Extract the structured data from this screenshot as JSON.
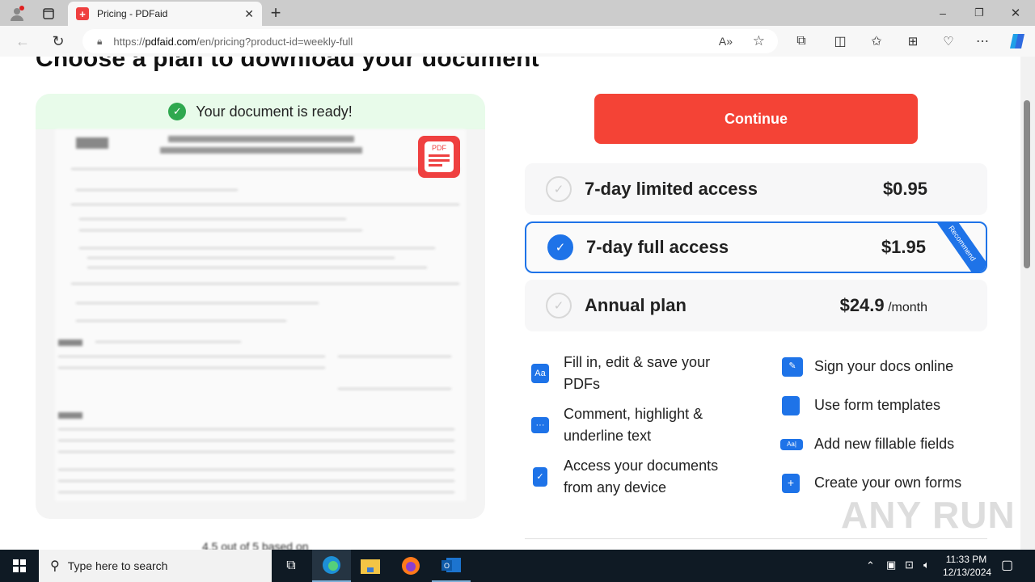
{
  "browser": {
    "tab_title": "Pricing - PDFaid",
    "url_prefix": "https://",
    "url_domain": "pdfaid.com",
    "url_path": "/en/pricing?product-id=weekly-full"
  },
  "page": {
    "heading": "Choose a plan to download your document",
    "ready_text": "Your document is ready!",
    "pdf_badge": "PDF",
    "continue_label": "Continue",
    "plans": [
      {
        "name": "7-day limited access",
        "price": "$0.95",
        "per": "",
        "selected": false
      },
      {
        "name": "7-day full access",
        "price": "$1.95",
        "per": "",
        "selected": true,
        "badge": "Recommend"
      },
      {
        "name": "Annual plan",
        "price": "$24.9",
        "per": " /month",
        "selected": false
      }
    ],
    "features_left": [
      {
        "icon": "document-edit-icon",
        "text": "Fill in, edit & save your PDFs"
      },
      {
        "icon": "comment-icon",
        "text": "Comment, highlight & underline text"
      },
      {
        "icon": "lock-icon",
        "text": "Access your documents from any device"
      }
    ],
    "features_right": [
      {
        "icon": "signature-icon",
        "text": "Sign your docs online"
      },
      {
        "icon": "template-icon",
        "text": "Use form templates"
      },
      {
        "icon": "fillable-field-icon",
        "text": "Add new fillable fields"
      },
      {
        "icon": "create-form-icon",
        "text": "Create your own forms"
      }
    ],
    "rating_text": "4.5 out of 5 based on"
  },
  "watermark": "ANY RUN",
  "taskbar": {
    "search_placeholder": "Type here to search",
    "time": "11:33 PM",
    "date": "12/13/2024"
  }
}
